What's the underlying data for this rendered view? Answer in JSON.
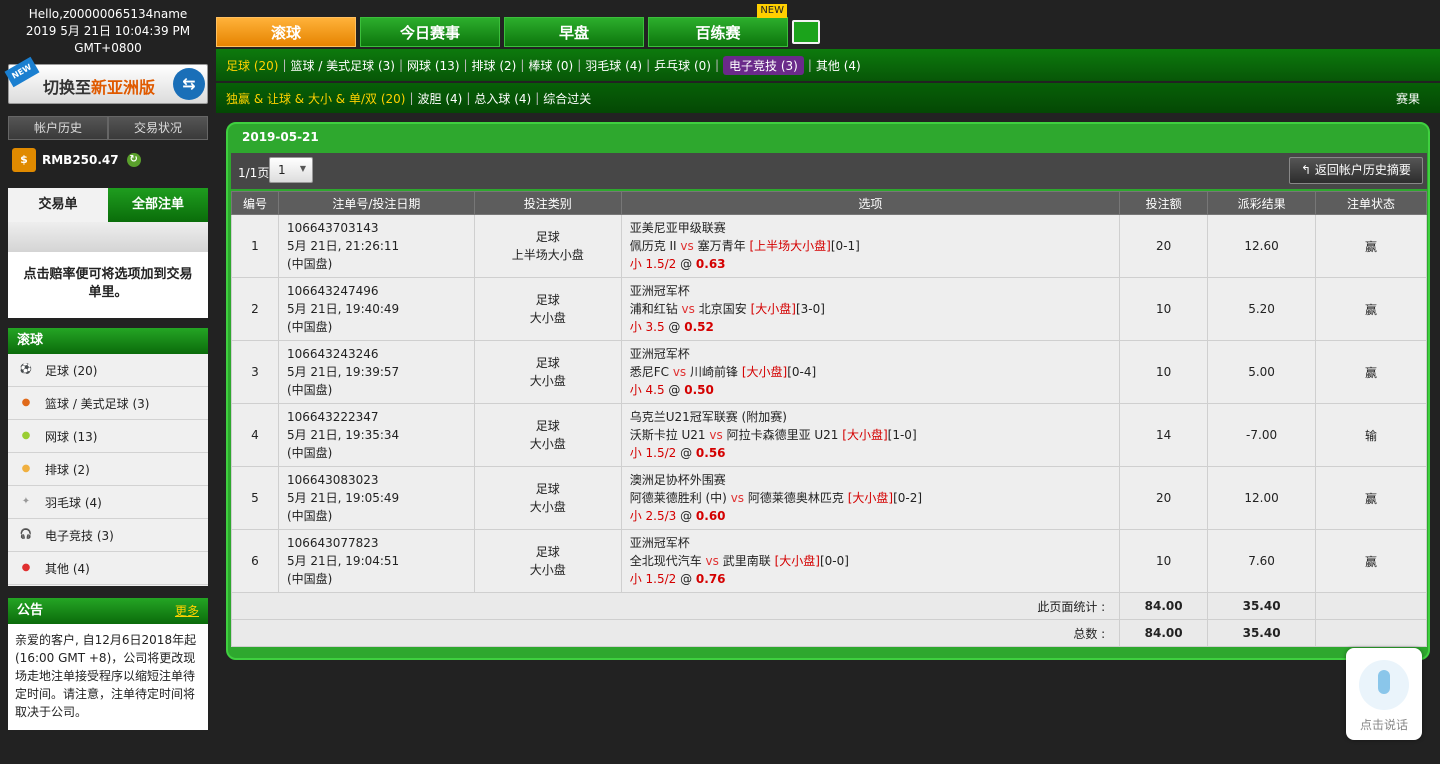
{
  "header": {
    "greeting": "Hello,z00000065134name",
    "datetime": "2019 5月 21日 10:04:39 PM GMT+0800"
  },
  "sidebar": {
    "switch_banner": {
      "new_tag": "NEW",
      "text_prefix": "切换至",
      "text_highlight": "新亚洲版"
    },
    "account_history": "帐户历史",
    "trade_status": "交易状况",
    "balance": "RMB250.47",
    "balance_icon": "coin-icon",
    "slip_tab_trade": "交易单",
    "slip_tab_all": "全部注单",
    "slip_message": "点击赔率便可将选项加到交易单里。",
    "live_title": "滚球",
    "live_items": [
      {
        "label": "足球 (20)",
        "icon": "soccer-icon",
        "color": "#333"
      },
      {
        "label": "篮球 / 美式足球 (3)",
        "icon": "basketball-icon",
        "color": "#e06a1a"
      },
      {
        "label": "网球 (13)",
        "icon": "tennis-icon",
        "color": "#9acd32"
      },
      {
        "label": "排球 (2)",
        "icon": "volleyball-icon",
        "color": "#f0b040"
      },
      {
        "label": "羽毛球 (4)",
        "icon": "badminton-icon",
        "color": "#999"
      },
      {
        "label": "电子竞技 (3)",
        "icon": "headset-icon",
        "color": "#555"
      },
      {
        "label": "其他 (4)",
        "icon": "other-sports-icon",
        "color": "#e03030"
      }
    ],
    "notice_title": "公告",
    "notice_more": "更多",
    "notice_body": "亲爱的客户, 自12月6日2018年起(16:00 GMT +8)，公司将更改现场走地注单接受程序以缩短注单待定时间。请注意，注单待定时间将取决于公司。"
  },
  "top_tabs": [
    {
      "label": "滚球",
      "active": true
    },
    {
      "label": "今日赛事",
      "active": false
    },
    {
      "label": "早盘",
      "active": false
    },
    {
      "label": "百练赛",
      "active": false,
      "badge": "NEW"
    }
  ],
  "sport_bar": [
    {
      "label": "足球 (20)",
      "active": true
    },
    {
      "label": "篮球 / 美式足球 (3)"
    },
    {
      "label": "网球 (13)"
    },
    {
      "label": "排球 (2)"
    },
    {
      "label": "棒球 (0)"
    },
    {
      "label": "羽毛球 (4)"
    },
    {
      "label": "乒乓球 (0)"
    },
    {
      "label": "电子竞技 (3)",
      "esports": true
    },
    {
      "label": "其他 (4)"
    }
  ],
  "market_bar": {
    "active": "独赢 & 让球 & 大小 & 单/双 (20)",
    "items": [
      "波胆 (4)",
      "总入球 (4)",
      "综合过关"
    ],
    "right": "赛果"
  },
  "panel": {
    "date": "2019-05-21",
    "page_label": "1/1页",
    "page_value": "1",
    "back_button": "返回帐户历史摘要"
  },
  "table": {
    "headers": [
      "编号",
      "注单号/投注日期",
      "投注类别",
      "选项",
      "投注额",
      "派彩结果",
      "注单状态"
    ],
    "rows": [
      {
        "no": "1",
        "id": "106643703143",
        "date": "5月 21日, 21:26:11",
        "odds_type": "(中国盘)",
        "sport": "足球",
        "bet_type": "上半场大小盘",
        "league": "亚美尼亚甲级联赛",
        "home": "佩历克 II",
        "vs": "vs",
        "away": "塞万青年",
        "market": "[上半场大小盘]",
        "score": "[0-1]",
        "selection": "小 1.5/2",
        "at": "@",
        "odds": "0.63",
        "stake": "20",
        "result": "12.60",
        "status": "赢",
        "won": true
      },
      {
        "no": "2",
        "id": "106643247496",
        "date": "5月 21日, 19:40:49",
        "odds_type": "(中国盘)",
        "sport": "足球",
        "bet_type": "大小盘",
        "league": "亚洲冠军杯",
        "home": "浦和红钻",
        "vs": "vs",
        "away": "北京国安",
        "market": "[大小盘]",
        "score": "[3-0]",
        "selection": "小 3.5",
        "at": "@",
        "odds": "0.52",
        "stake": "10",
        "result": "5.20",
        "status": "赢",
        "won": true
      },
      {
        "no": "3",
        "id": "106643243246",
        "date": "5月 21日, 19:39:57",
        "odds_type": "(中国盘)",
        "sport": "足球",
        "bet_type": "大小盘",
        "league": "亚洲冠军杯",
        "home": "悉尼FC",
        "vs": "vs",
        "away": "川崎前锋",
        "market": "[大小盘]",
        "score": "[0-4]",
        "selection": "小 4.5",
        "at": "@",
        "odds": "0.50",
        "stake": "10",
        "result": "5.00",
        "status": "赢",
        "won": true
      },
      {
        "no": "4",
        "id": "106643222347",
        "date": "5月 21日, 19:35:34",
        "odds_type": "(中国盘)",
        "sport": "足球",
        "bet_type": "大小盘",
        "league": "乌克兰U21冠军联赛 (附加赛)",
        "home": "沃斯卡拉 U21",
        "vs": "vs",
        "away": "阿拉卡森德里亚 U21",
        "market": "[大小盘]",
        "score": "[1-0]",
        "selection": "小 1.5/2",
        "at": "@",
        "odds": "0.56",
        "stake": "14",
        "result": "-7.00",
        "status": "输",
        "won": false
      },
      {
        "no": "5",
        "id": "106643083023",
        "date": "5月 21日, 19:05:49",
        "odds_type": "(中国盘)",
        "sport": "足球",
        "bet_type": "大小盘",
        "league": "澳洲足协杯外围赛",
        "home": "阿德莱德胜利 (中)",
        "vs": "vs",
        "away": "阿德莱德奥林匹克",
        "market": "[大小盘]",
        "score": "[0-2]",
        "selection": "小 2.5/3",
        "at": "@",
        "odds": "0.60",
        "stake": "20",
        "result": "12.00",
        "status": "赢",
        "won": true
      },
      {
        "no": "6",
        "id": "106643077823",
        "date": "5月 21日, 19:04:51",
        "odds_type": "(中国盘)",
        "sport": "足球",
        "bet_type": "大小盘",
        "league": "亚洲冠军杯",
        "home": "全北现代汽车",
        "vs": "vs",
        "away": "武里南联",
        "market": "[大小盘]",
        "score": "[0-0]",
        "selection": "小 1.5/2",
        "at": "@",
        "odds": "0.76",
        "stake": "10",
        "result": "7.60",
        "status": "赢",
        "won": true
      }
    ],
    "page_total_label": "此页面统计 :",
    "page_total_stake": "84.00",
    "page_total_result": "35.40",
    "grand_total_label": "总数 :",
    "grand_total_stake": "84.00",
    "grand_total_result": "35.40"
  },
  "voice": {
    "label": "点击说话"
  },
  "colors": {
    "brand_green": "#0d760d",
    "active_orange": "#f09a10",
    "highlight_yellow": "#ffd200",
    "win_green": "#3a9a1a",
    "lose_red": "#d40000"
  }
}
